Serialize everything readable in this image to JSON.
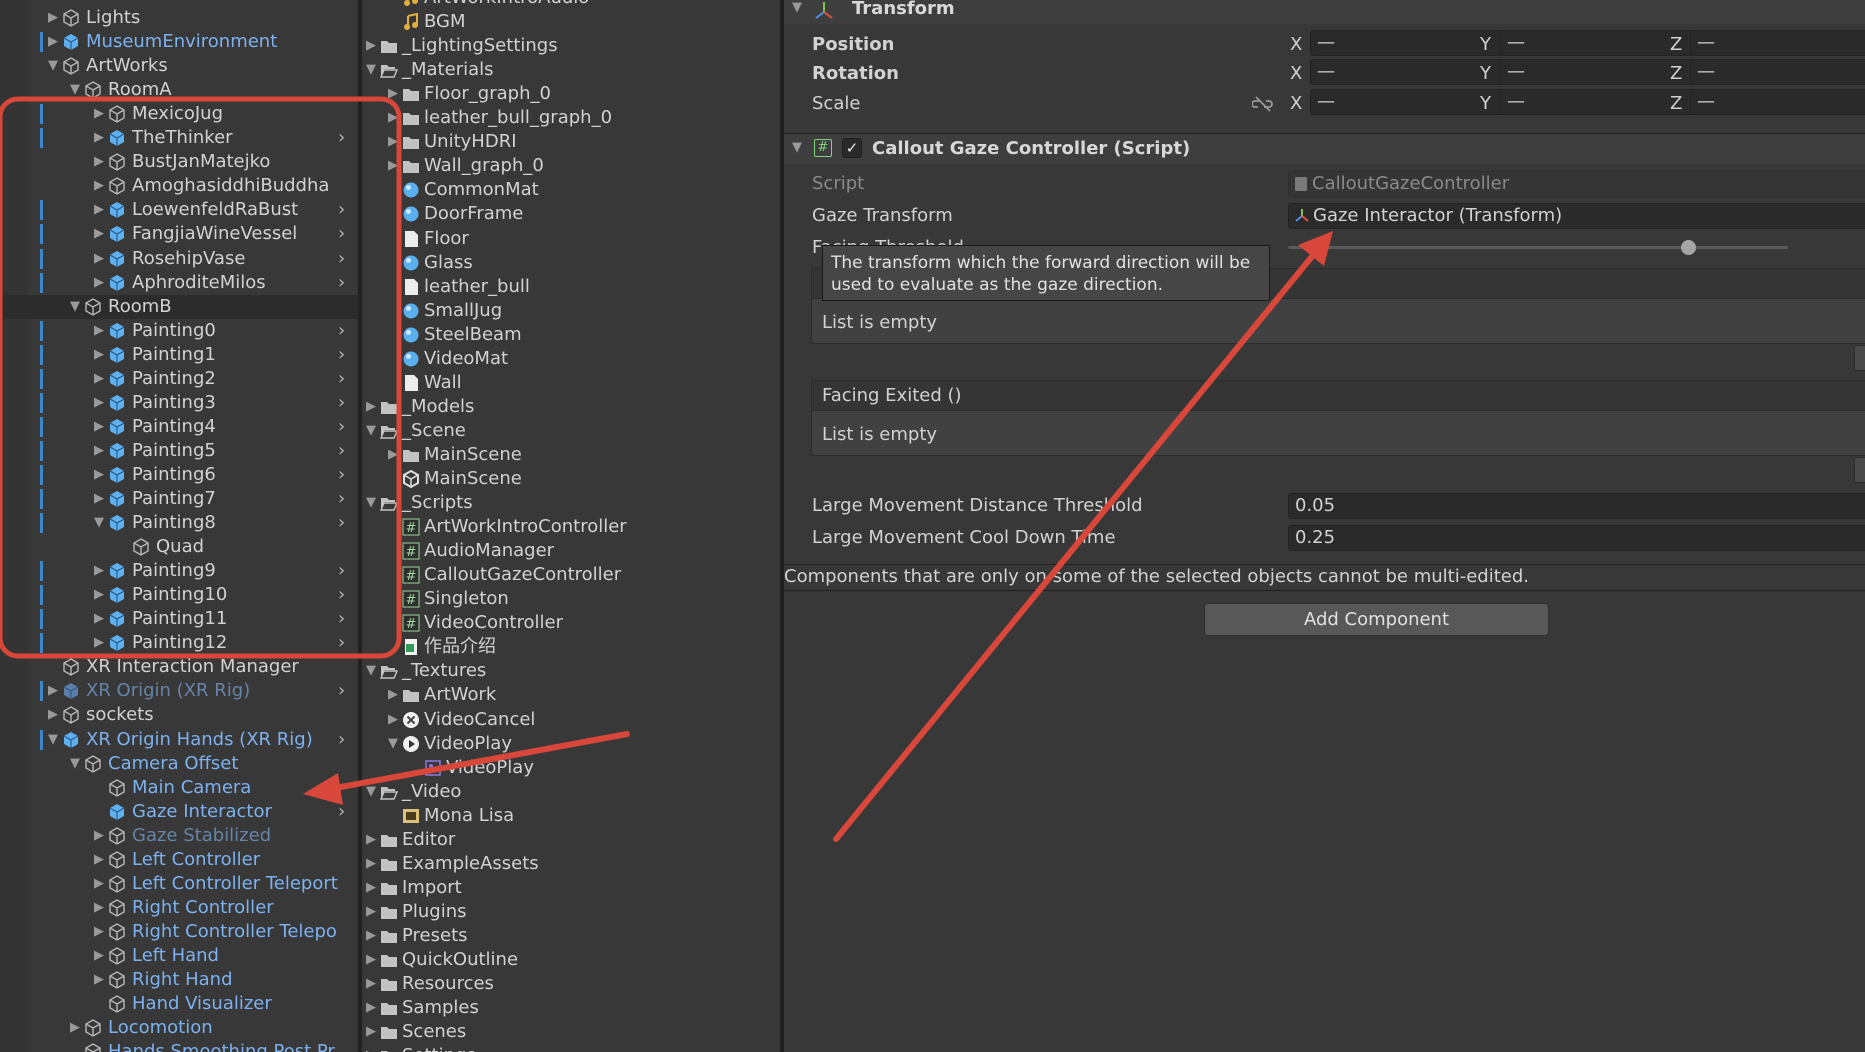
{
  "hierarchy": {
    "rows": [
      {
        "label": "Lights",
        "indent": 0,
        "arrow": "right",
        "color": "white",
        "icon": "gameobject-icon",
        "bar": false
      },
      {
        "label": "MuseumEnvironment",
        "indent": 0,
        "arrow": "right",
        "color": "blue",
        "icon": "prefab-icon",
        "bar": true
      },
      {
        "label": "ArtWorks",
        "indent": 0,
        "arrow": "down",
        "color": "white",
        "icon": "gameobject-icon",
        "bar": false
      },
      {
        "label": "RoomA",
        "indent": 1,
        "arrow": "down",
        "color": "white",
        "icon": "gameobject-icon",
        "bar": false
      },
      {
        "label": "MexicoJug",
        "indent": 2,
        "arrow": "right",
        "color": "white",
        "icon": "gameobject-icon",
        "bar": true
      },
      {
        "label": "TheThinker",
        "indent": 2,
        "arrow": "right",
        "color": "white",
        "icon": "prefab-icon",
        "bar": true,
        "chev": true
      },
      {
        "label": "BustJanMatejko",
        "indent": 2,
        "arrow": "right",
        "color": "white",
        "icon": "gameobject-icon",
        "bar": false
      },
      {
        "label": "AmoghasiddhiBuddha",
        "indent": 2,
        "arrow": "right",
        "color": "white",
        "icon": "gameobject-icon",
        "bar": false
      },
      {
        "label": "LoewenfeldRaBust",
        "indent": 2,
        "arrow": "right",
        "color": "white",
        "icon": "prefab-icon",
        "bar": true,
        "chev": true
      },
      {
        "label": "FangjiaWineVessel",
        "indent": 2,
        "arrow": "right",
        "color": "white",
        "icon": "prefab-icon",
        "bar": true,
        "chev": true
      },
      {
        "label": "RosehipVase",
        "indent": 2,
        "arrow": "right",
        "color": "white",
        "icon": "prefab-icon",
        "bar": true,
        "chev": true
      },
      {
        "label": "AphroditeMilos",
        "indent": 2,
        "arrow": "right",
        "color": "white",
        "icon": "prefab-icon",
        "bar": true,
        "chev": true
      },
      {
        "label": "RoomB",
        "indent": 1,
        "arrow": "down",
        "color": "white",
        "icon": "gameobject-icon",
        "bar": false,
        "selected": true
      },
      {
        "label": "Painting0",
        "indent": 2,
        "arrow": "right",
        "color": "white",
        "icon": "prefab-icon",
        "bar": true,
        "chev": true
      },
      {
        "label": "Painting1",
        "indent": 2,
        "arrow": "right",
        "color": "white",
        "icon": "prefab-icon",
        "bar": true,
        "chev": true
      },
      {
        "label": "Painting2",
        "indent": 2,
        "arrow": "right",
        "color": "white",
        "icon": "prefab-icon",
        "bar": true,
        "chev": true
      },
      {
        "label": "Painting3",
        "indent": 2,
        "arrow": "right",
        "color": "white",
        "icon": "prefab-icon",
        "bar": true,
        "chev": true
      },
      {
        "label": "Painting4",
        "indent": 2,
        "arrow": "right",
        "color": "white",
        "icon": "prefab-icon",
        "bar": true,
        "chev": true
      },
      {
        "label": "Painting5",
        "indent": 2,
        "arrow": "right",
        "color": "white",
        "icon": "prefab-icon",
        "bar": true,
        "chev": true
      },
      {
        "label": "Painting6",
        "indent": 2,
        "arrow": "right",
        "color": "white",
        "icon": "prefab-icon",
        "bar": true,
        "chev": true
      },
      {
        "label": "Painting7",
        "indent": 2,
        "arrow": "right",
        "color": "white",
        "icon": "prefab-icon",
        "bar": true,
        "chev": true
      },
      {
        "label": "Painting8",
        "indent": 2,
        "arrow": "down",
        "color": "white",
        "icon": "prefab-icon",
        "bar": true,
        "chev": true
      },
      {
        "label": "Quad",
        "indent": 3,
        "arrow": "none",
        "color": "white",
        "icon": "gameobject-icon",
        "bar": false
      },
      {
        "label": "Painting9",
        "indent": 2,
        "arrow": "right",
        "color": "white",
        "icon": "prefab-icon",
        "bar": true,
        "chev": true
      },
      {
        "label": "Painting10",
        "indent": 2,
        "arrow": "right",
        "color": "white",
        "icon": "prefab-icon",
        "bar": true,
        "chev": true
      },
      {
        "label": "Painting11",
        "indent": 2,
        "arrow": "right",
        "color": "white",
        "icon": "prefab-icon",
        "bar": true,
        "chev": true
      },
      {
        "label": "Painting12",
        "indent": 2,
        "arrow": "right",
        "color": "white",
        "icon": "prefab-icon",
        "bar": true,
        "chev": true
      },
      {
        "label": "XR Interaction Manager",
        "indent": 0,
        "arrow": "none",
        "color": "white",
        "icon": "gameobject-icon",
        "bar": false
      },
      {
        "label": "XR Origin (XR Rig)",
        "indent": 0,
        "arrow": "right",
        "color": "dim",
        "icon": "prefab-icon",
        "bar": true,
        "chev": true
      },
      {
        "label": "sockets",
        "indent": 0,
        "arrow": "right",
        "color": "white",
        "icon": "gameobject-icon",
        "bar": false
      },
      {
        "label": "XR Origin Hands (XR Rig)",
        "indent": 0,
        "arrow": "down",
        "color": "blue",
        "icon": "prefab-variant-icon",
        "bar": true,
        "chev": true
      },
      {
        "label": "Camera Offset",
        "indent": 1,
        "arrow": "down",
        "color": "blue",
        "icon": "gameobject-icon",
        "bar": false
      },
      {
        "label": "Main Camera",
        "indent": 2,
        "arrow": "none",
        "color": "blue",
        "icon": "gameobject-icon",
        "bar": false
      },
      {
        "label": "Gaze Interactor",
        "indent": 2,
        "arrow": "none",
        "color": "blue",
        "icon": "prefab-icon",
        "bar": false,
        "chev": true
      },
      {
        "label": "Gaze Stabilized",
        "indent": 2,
        "arrow": "right",
        "color": "dim",
        "icon": "gameobject-icon",
        "bar": false
      },
      {
        "label": "Left Controller",
        "indent": 2,
        "arrow": "right",
        "color": "blue",
        "icon": "gameobject-icon",
        "bar": false
      },
      {
        "label": "Left Controller Teleport",
        "indent": 2,
        "arrow": "right",
        "color": "blue",
        "icon": "gameobject-icon",
        "bar": false
      },
      {
        "label": "Right Controller",
        "indent": 2,
        "arrow": "right",
        "color": "blue",
        "icon": "gameobject-icon",
        "bar": false
      },
      {
        "label": "Right Controller Telepo",
        "indent": 2,
        "arrow": "right",
        "color": "blue",
        "icon": "gameobject-icon",
        "bar": false
      },
      {
        "label": "Left Hand",
        "indent": 2,
        "arrow": "right",
        "color": "blue",
        "icon": "gameobject-icon",
        "bar": false
      },
      {
        "label": "Right Hand",
        "indent": 2,
        "arrow": "right",
        "color": "blue",
        "icon": "gameobject-icon",
        "bar": false
      },
      {
        "label": "Hand Visualizer",
        "indent": 2,
        "arrow": "none",
        "color": "blue",
        "icon": "gameobject-icon",
        "bar": false
      },
      {
        "label": "Locomotion",
        "indent": 1,
        "arrow": "right",
        "color": "blue",
        "icon": "gameobject-icon",
        "bar": false
      },
      {
        "label": "Hands Smoothing Post Pr",
        "indent": 1,
        "arrow": "none",
        "color": "blue",
        "icon": "gameobject-icon",
        "bar": false
      }
    ]
  },
  "project": {
    "rows": [
      {
        "label": "ArtWorkIntroAudio",
        "indent": 1,
        "arrow": "none",
        "icon": "audio-icon"
      },
      {
        "label": "BGM",
        "indent": 1,
        "arrow": "none",
        "icon": "audio-icon"
      },
      {
        "label": "_LightingSettings",
        "indent": 0,
        "arrow": "right",
        "icon": "folder-icon"
      },
      {
        "label": "_Materials",
        "indent": 0,
        "arrow": "down",
        "icon": "folder-open-icon"
      },
      {
        "label": "Floor_graph_0",
        "indent": 1,
        "arrow": "right",
        "icon": "folder-icon"
      },
      {
        "label": "leather_bull_graph_0",
        "indent": 1,
        "arrow": "right",
        "icon": "folder-icon"
      },
      {
        "label": "UnityHDRI",
        "indent": 1,
        "arrow": "right",
        "icon": "folder-icon"
      },
      {
        "label": "Wall_graph_0",
        "indent": 1,
        "arrow": "right",
        "icon": "folder-icon"
      },
      {
        "label": "CommonMat",
        "indent": 1,
        "arrow": "none",
        "icon": "material-icon"
      },
      {
        "label": "DoorFrame",
        "indent": 1,
        "arrow": "none",
        "icon": "material-icon"
      },
      {
        "label": "Floor",
        "indent": 1,
        "arrow": "none",
        "icon": "file-icon"
      },
      {
        "label": "Glass",
        "indent": 1,
        "arrow": "none",
        "icon": "material-icon"
      },
      {
        "label": "leather_bull",
        "indent": 1,
        "arrow": "none",
        "icon": "file-icon"
      },
      {
        "label": "SmallJug",
        "indent": 1,
        "arrow": "none",
        "icon": "material-icon"
      },
      {
        "label": "SteelBeam",
        "indent": 1,
        "arrow": "none",
        "icon": "material-icon"
      },
      {
        "label": "VideoMat",
        "indent": 1,
        "arrow": "none",
        "icon": "material-icon"
      },
      {
        "label": "Wall",
        "indent": 1,
        "arrow": "none",
        "icon": "file-icon"
      },
      {
        "label": "_Models",
        "indent": 0,
        "arrow": "right",
        "icon": "folder-icon"
      },
      {
        "label": "_Scene",
        "indent": 0,
        "arrow": "down",
        "icon": "folder-open-icon"
      },
      {
        "label": "MainScene",
        "indent": 1,
        "arrow": "right",
        "icon": "folder-icon"
      },
      {
        "label": "MainScene",
        "indent": 1,
        "arrow": "none",
        "icon": "scene-icon"
      },
      {
        "label": "_Scripts",
        "indent": 0,
        "arrow": "down",
        "icon": "folder-open-icon"
      },
      {
        "label": "ArtWorkIntroController",
        "indent": 1,
        "arrow": "none",
        "icon": "script-icon"
      },
      {
        "label": "AudioManager",
        "indent": 1,
        "arrow": "none",
        "icon": "script-icon"
      },
      {
        "label": "CalloutGazeController",
        "indent": 1,
        "arrow": "none",
        "icon": "script-icon"
      },
      {
        "label": "Singleton",
        "indent": 1,
        "arrow": "none",
        "icon": "script-icon"
      },
      {
        "label": "VideoController",
        "indent": 1,
        "arrow": "none",
        "icon": "script-icon"
      },
      {
        "label": "作品介绍",
        "indent": 1,
        "arrow": "none",
        "icon": "spreadsheet-icon"
      },
      {
        "label": "_Textures",
        "indent": 0,
        "arrow": "down",
        "icon": "folder-open-icon"
      },
      {
        "label": "ArtWork",
        "indent": 1,
        "arrow": "right",
        "icon": "folder-icon"
      },
      {
        "label": "VideoCancel",
        "indent": 1,
        "arrow": "right",
        "icon": "cancel-texture-icon"
      },
      {
        "label": "VideoPlay",
        "indent": 1,
        "arrow": "down",
        "icon": "play-texture-icon"
      },
      {
        "label": "VideoPlay",
        "indent": 2,
        "arrow": "none",
        "icon": "sprite-icon"
      },
      {
        "label": "_Video",
        "indent": 0,
        "arrow": "down",
        "icon": "folder-open-icon"
      },
      {
        "label": "Mona Lisa",
        "indent": 1,
        "arrow": "none",
        "icon": "video-clip-icon"
      },
      {
        "label": "Editor",
        "indent": 0,
        "arrow": "right",
        "icon": "folder-icon"
      },
      {
        "label": "ExampleAssets",
        "indent": 0,
        "arrow": "right",
        "icon": "folder-icon"
      },
      {
        "label": "Import",
        "indent": 0,
        "arrow": "right",
        "icon": "folder-icon"
      },
      {
        "label": "Plugins",
        "indent": 0,
        "arrow": "right",
        "icon": "folder-icon"
      },
      {
        "label": "Presets",
        "indent": 0,
        "arrow": "right",
        "icon": "folder-icon"
      },
      {
        "label": "QuickOutline",
        "indent": 0,
        "arrow": "right",
        "icon": "folder-icon"
      },
      {
        "label": "Resources",
        "indent": 0,
        "arrow": "right",
        "icon": "folder-icon"
      },
      {
        "label": "Samples",
        "indent": 0,
        "arrow": "right",
        "icon": "folder-icon"
      },
      {
        "label": "Scenes",
        "indent": 0,
        "arrow": "right",
        "icon": "folder-icon"
      },
      {
        "label": "Settings",
        "indent": 0,
        "arrow": "right",
        "icon": "folder-icon"
      }
    ]
  },
  "inspector": {
    "transform": {
      "title": "Transform",
      "position_label": "Position",
      "rotation_label": "Rotation",
      "scale_label": "Scale",
      "x": "X",
      "y": "Y",
      "z": "Z",
      "mixed": "—"
    },
    "callout": {
      "title": "Callout Gaze Controller (Script)",
      "script_label": "Script",
      "script_value": "CalloutGazeController",
      "gaze_transform_label": "Gaze Transform",
      "gaze_transform_value": "Gaze Interactor (Transform)",
      "facing_threshold_partial": "Facing Threshold",
      "tooltip": "The transform which the forward direction will be used to evaluate as the gaze direction.",
      "list_empty_1": "List is empty",
      "facing_exited": "Facing Exited ()",
      "list_empty_2": "List is empty",
      "large_move_dist_label": "Large Movement Distance Threshold",
      "large_move_dist_value": "0.05",
      "large_move_cool_label": "Large Movement Cool Down Time",
      "large_move_cool_value": "0.25",
      "slider_value": 0.8
    },
    "notice": "Components that are only on some of the selected objects cannot be multi-edited.",
    "add_component": "Add Component"
  },
  "colors": {
    "accent_blue": "#7db1f0",
    "annotation_red": "#d9463a",
    "panel_bg": "#383838"
  }
}
